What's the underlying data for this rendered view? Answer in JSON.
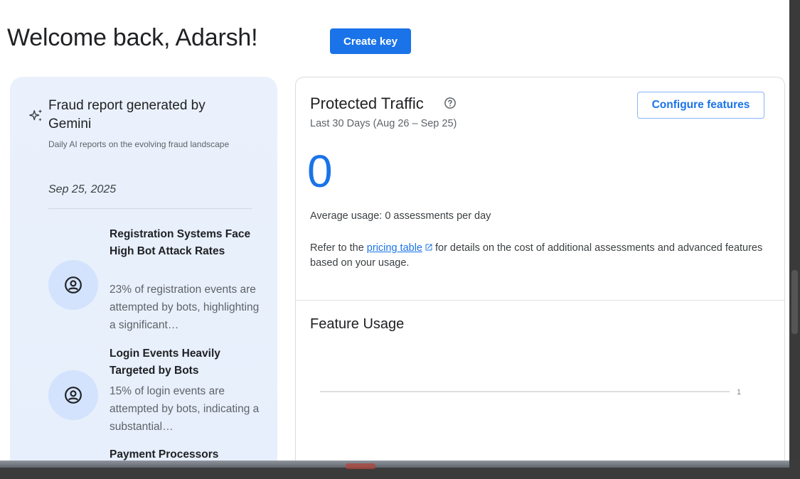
{
  "header": {
    "title": "Welcome back, Adarsh!",
    "create_key_label": "Create key"
  },
  "report": {
    "title": "Fraud report generated by Gemini",
    "subtitle": "Daily AI reports on the evolving fraud landscape",
    "date": "Sep 25, 2025",
    "icon": "sparkle-icon",
    "insights": [
      {
        "title": "Registration Systems Face High Bot Attack Rates",
        "description": "23% of registration events are attempted by bots, highlighting a significant…",
        "icon": "face-icon"
      },
      {
        "title": "Login Events Heavily Targeted by Bots",
        "description": "15% of login events are attempted by bots, indicating a substantial…",
        "icon": "face-icon"
      },
      {
        "title": "Payment Processors",
        "description": "",
        "icon": "face-icon"
      }
    ]
  },
  "traffic": {
    "title": "Protected Traffic",
    "range": "Last 30 Days (Aug 26 – Sep 25)",
    "configure_label": "Configure features",
    "count": "0",
    "avg_usage": "Average usage: 0 assessments per day",
    "pricing_prefix": "Refer to the",
    "pricing_link": "pricing table",
    "pricing_suffix": "for details on the cost of additional assessments and advanced features based on your usage."
  },
  "feature_usage": {
    "title": "Feature Usage",
    "axis_tick": "1"
  },
  "colors": {
    "accent": "#1a73e8",
    "card_bg": "#e8f0fe",
    "avatar_bg": "#d3e3fd"
  }
}
